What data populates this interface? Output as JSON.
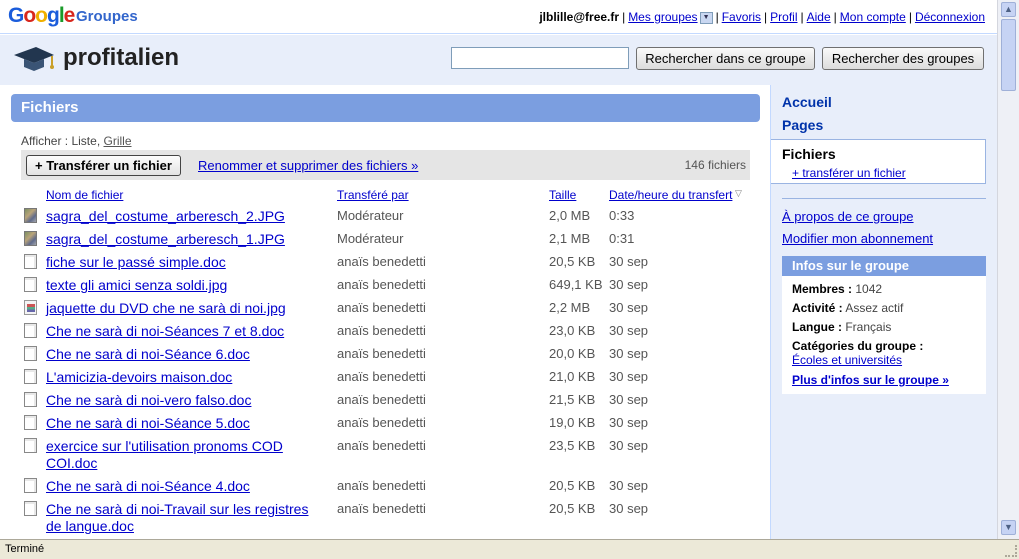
{
  "topbar": {
    "logo_google": [
      "G",
      "o",
      "o",
      "g",
      "l",
      "e"
    ],
    "logo_product": "Groupes",
    "user_email": "jlblille@free.fr",
    "links": {
      "my_groups": "Mes groupes",
      "favorites": "Favoris",
      "profile": "Profil",
      "help": "Aide",
      "account": "Mon compte",
      "logout": "Déconnexion"
    },
    "separator": "|"
  },
  "header": {
    "group_name": "profitalien",
    "search_value": "",
    "search_group_button": "Rechercher dans ce groupe",
    "search_groups_button": "Rechercher des groupes"
  },
  "files": {
    "title": "Fichiers",
    "display_label": "Afficher : Liste,",
    "grid_link": "Grille",
    "upload_button": "+ Transférer un fichier",
    "rename_link": "Renommer et supprimer des fichiers »",
    "count": "146 fichiers",
    "columns": {
      "name": "Nom de fichier",
      "by": "Transféré par",
      "size": "Taille",
      "date": "Date/heure du transfert"
    },
    "rows": [
      {
        "icon": "image-thumbnail-icon",
        "name": "sagra_del_costume_arberesch_2.JPG",
        "by": "Modérateur",
        "size": "2,0 MB",
        "date": "0:33"
      },
      {
        "icon": "image-thumbnail-icon",
        "name": "sagra_del_costume_arberesch_1.JPG",
        "by": "Modérateur",
        "size": "2,1 MB",
        "date": "0:31"
      },
      {
        "icon": "document-icon",
        "name": "fiche sur le passé simple.doc",
        "by": "anaïs benedetti",
        "size": "20,5 KB",
        "date": "30 sep"
      },
      {
        "icon": "document-icon",
        "name": "texte gli amici senza soldi.jpg",
        "by": "anaïs benedetti",
        "size": "649,1 KB",
        "date": "30 sep"
      },
      {
        "icon": "image-file-icon",
        "name": "jaquette du DVD che ne sarà di noi.jpg",
        "by": "anaïs benedetti",
        "size": "2,2 MB",
        "date": "30 sep"
      },
      {
        "icon": "document-icon",
        "name": "Che ne sarà di noi-Séances 7 et 8.doc",
        "by": "anaïs benedetti",
        "size": "23,0 KB",
        "date": "30 sep"
      },
      {
        "icon": "document-icon",
        "name": "Che ne sarà di noi-Séance 6.doc",
        "by": "anaïs benedetti",
        "size": "20,0 KB",
        "date": "30 sep"
      },
      {
        "icon": "document-icon",
        "name": "L'amicizia-devoirs maison.doc",
        "by": "anaïs benedetti",
        "size": "21,0 KB",
        "date": "30 sep"
      },
      {
        "icon": "document-icon",
        "name": "Che ne sarà di noi-vero falso.doc",
        "by": "anaïs benedetti",
        "size": "21,5 KB",
        "date": "30 sep"
      },
      {
        "icon": "document-icon",
        "name": "Che ne sarà di noi-Séance 5.doc",
        "by": "anaïs benedetti",
        "size": "19,0 KB",
        "date": "30 sep"
      },
      {
        "icon": "document-icon",
        "name": "exercice sur l'utilisation pronoms COD COI.doc",
        "by": "anaïs benedetti",
        "size": "23,5 KB",
        "date": "30 sep"
      },
      {
        "icon": "document-icon",
        "name": "Che ne sarà di noi-Séance 4.doc",
        "by": "anaïs benedetti",
        "size": "20,5 KB",
        "date": "30 sep"
      },
      {
        "icon": "document-icon",
        "name": "Che ne sarà di noi-Travail sur les registres de langue.doc",
        "by": "anaïs benedetti",
        "size": "20,5 KB",
        "date": "30 sep"
      }
    ]
  },
  "sidebar": {
    "home": "Accueil",
    "pages": "Pages",
    "files": "Fichiers",
    "upload_link": "+ transférer un fichier",
    "about_link": "À propos de ce groupe",
    "subscription_link": "Modifier mon abonnement",
    "info": {
      "title": "Infos sur le groupe",
      "members_label": "Membres :",
      "members_value": "1042",
      "activity_label": "Activité :",
      "activity_value": "Assez actif",
      "language_label": "Langue :",
      "language_value": "Français",
      "categories_label": "Catégories du groupe :",
      "category_link": "Écoles et universités",
      "more_link": "Plus d'infos sur le groupe »"
    }
  },
  "statusbar": {
    "text": "Terminé"
  },
  "colors": {
    "accent_blue": "#7b9ee0",
    "light_blue_bg": "#e8eefa",
    "link": "#0000cc"
  }
}
